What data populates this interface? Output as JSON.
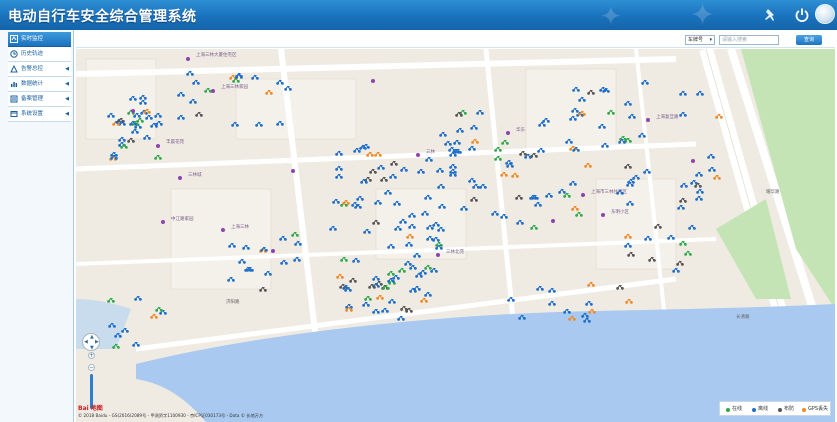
{
  "app": {
    "title": "电动自行车安全综合管理系统"
  },
  "header_icons": [
    "pin-icon",
    "power-icon",
    "avatar"
  ],
  "sidebar": {
    "items": [
      {
        "label": "实时监控",
        "icon": "map-icon",
        "active": true,
        "has_arrow": false
      },
      {
        "label": "历史轨迹",
        "icon": "history-icon",
        "active": false,
        "has_arrow": false
      },
      {
        "label": "告警总控",
        "icon": "alarm-icon",
        "active": false,
        "has_arrow": true
      },
      {
        "label": "数据统计",
        "icon": "chart-icon",
        "active": false,
        "has_arrow": true
      },
      {
        "label": "备案管理",
        "icon": "register-icon",
        "active": false,
        "has_arrow": true
      },
      {
        "label": "系统设置",
        "icon": "settings-icon",
        "active": false,
        "has_arrow": true
      }
    ]
  },
  "toolbar": {
    "type_select_value": "车牌号",
    "plate_input_placeholder": "请输入搜索",
    "search_label": "查询"
  },
  "map": {
    "poi_labels": [
      "上海三林大厦住宅区",
      "上海三林家园",
      "丰晨花苑",
      "三林城",
      "中江路家园",
      "上海三林",
      "三林",
      "华东",
      "上海市三林住宅区",
      "东明小区",
      "上海复旦路",
      "三林北苑"
    ],
    "road_labels": [
      "济阳路",
      "长清路",
      "耀华路"
    ],
    "copyright": "© 2018 Baidu - GS(2016)2089号 - 甲测资字1100930 - 京ICP证030173号 - Data © 长地万方",
    "logo_text": "Bai 地图"
  },
  "legend": {
    "items": [
      {
        "label": "在线",
        "color": "#2fa84a"
      },
      {
        "label": "离线",
        "color": "#1f6fc9"
      },
      {
        "label": "布防",
        "color": "#555555"
      },
      {
        "label": "GPS丢失",
        "color": "#f08a24"
      }
    ]
  },
  "colors": {
    "header": "#1a72bd",
    "marker_blue": "#1f6fc9",
    "marker_green": "#2fa84a",
    "marker_gray": "#555555",
    "marker_orange": "#f08a24",
    "poi_purple": "#8e44ad",
    "river": "#a9c9f0",
    "greenland": "#bfe3b3"
  }
}
